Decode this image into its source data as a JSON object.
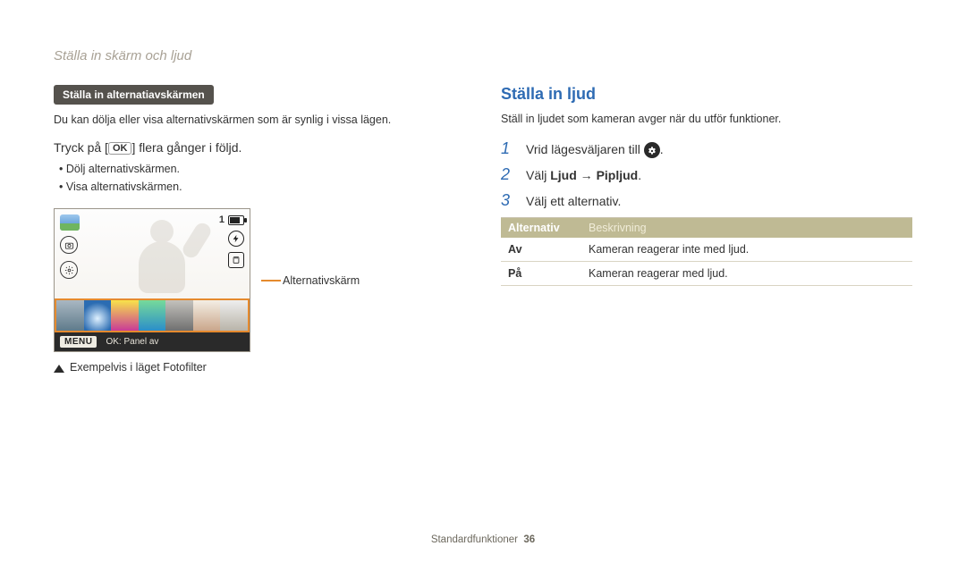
{
  "header": {
    "title": "Ställa in skärm och ljud"
  },
  "left": {
    "pill": "Ställa in alternatiavskärmen",
    "intro": "Du kan dölja eller visa alternativskärmen som är synlig i vissa lägen.",
    "press_prefix": "Tryck på [",
    "press_ok": "OK",
    "press_suffix": "] flera gånger i följd.",
    "bullets": [
      "Dölj alternativskärmen.",
      "Visa alternativskärmen."
    ],
    "screenshot": {
      "counter": "1",
      "menu_badge": "MENU",
      "bar_text": "OK: Panel av",
      "left_icons": {
        "camera": "camera-icon",
        "gear": "gear-icon"
      },
      "right_icons": {
        "flash": "flash-icon",
        "card": "card-icon",
        "battery": "battery-icon"
      }
    },
    "callout": "Alternativskärm",
    "caption": "Exempelvis i läget Fotofilter"
  },
  "right": {
    "heading": "Ställa in ljud",
    "intro": "Ställ in ljudet som kameran avger när du utför funktioner.",
    "steps": [
      {
        "num": "1",
        "pre": "Vrid lägesväljaren till ",
        "icon": "gear-fill-icon",
        "post": "."
      },
      {
        "num": "2",
        "text_pre": "Välj ",
        "bold1": "Ljud",
        "arrow": " → ",
        "bold2": "Pipljud",
        "text_post": "."
      },
      {
        "num": "3",
        "text": "Välj ett alternativ."
      }
    ],
    "table": {
      "headA": "Alternativ",
      "headB": "Beskrivning",
      "rows": [
        {
          "a": "Av",
          "b": "Kameran reagerar inte med ljud."
        },
        {
          "a": "På",
          "b": "Kameran reagerar med ljud."
        }
      ]
    }
  },
  "footer": {
    "section": "Standardfunktioner",
    "page": "36"
  }
}
